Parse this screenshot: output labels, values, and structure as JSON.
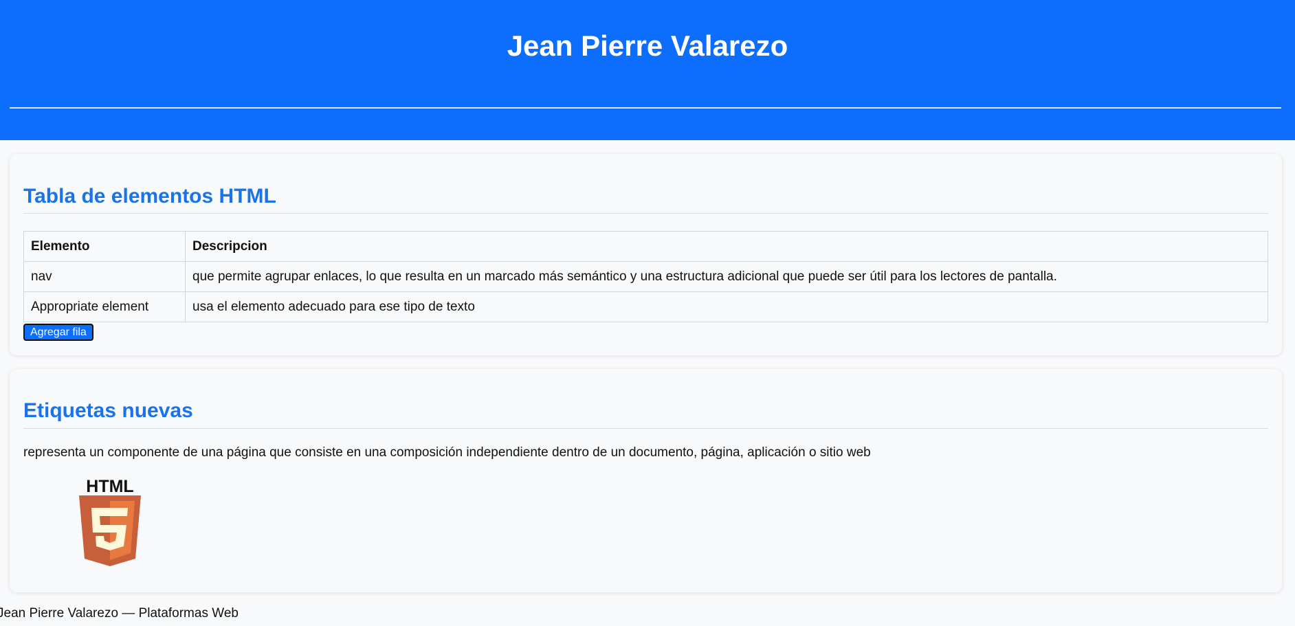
{
  "header": {
    "title": "Jean Pierre Valarezo"
  },
  "table_section": {
    "title": "Tabla de elementos HTML",
    "columns": [
      "Elemento",
      "Descripcion"
    ],
    "rows": [
      [
        "nav",
        "que permite agrupar enlaces, lo que resulta en un marcado más semántico y una estructura adicional que puede ser útil para los lectores de pantalla."
      ],
      [
        "Appropriate element",
        "usa el elemento adecuado para ese tipo de texto"
      ]
    ],
    "button_label": "Agregar fila"
  },
  "tags_section": {
    "title": "Etiquetas nuevas",
    "description": "representa un componente de una página que consiste en una composición independiente dentro de un documento, página, aplicación o sitio web",
    "logo_text": "HTML",
    "logo_icon": "html5-logo-icon",
    "logo_colors": {
      "shield_dark": "#c85f3b",
      "shield_light": "#e8793f",
      "five": "#fff7d9"
    }
  },
  "footer": {
    "text": "Jean Pierre Valarezo — Plataformas Web"
  },
  "colors": {
    "header_bg": "#0d6efd",
    "section_title": "#1a73e8",
    "button_bg": "#0d6efd",
    "page_bg": "#f8f9fa"
  }
}
